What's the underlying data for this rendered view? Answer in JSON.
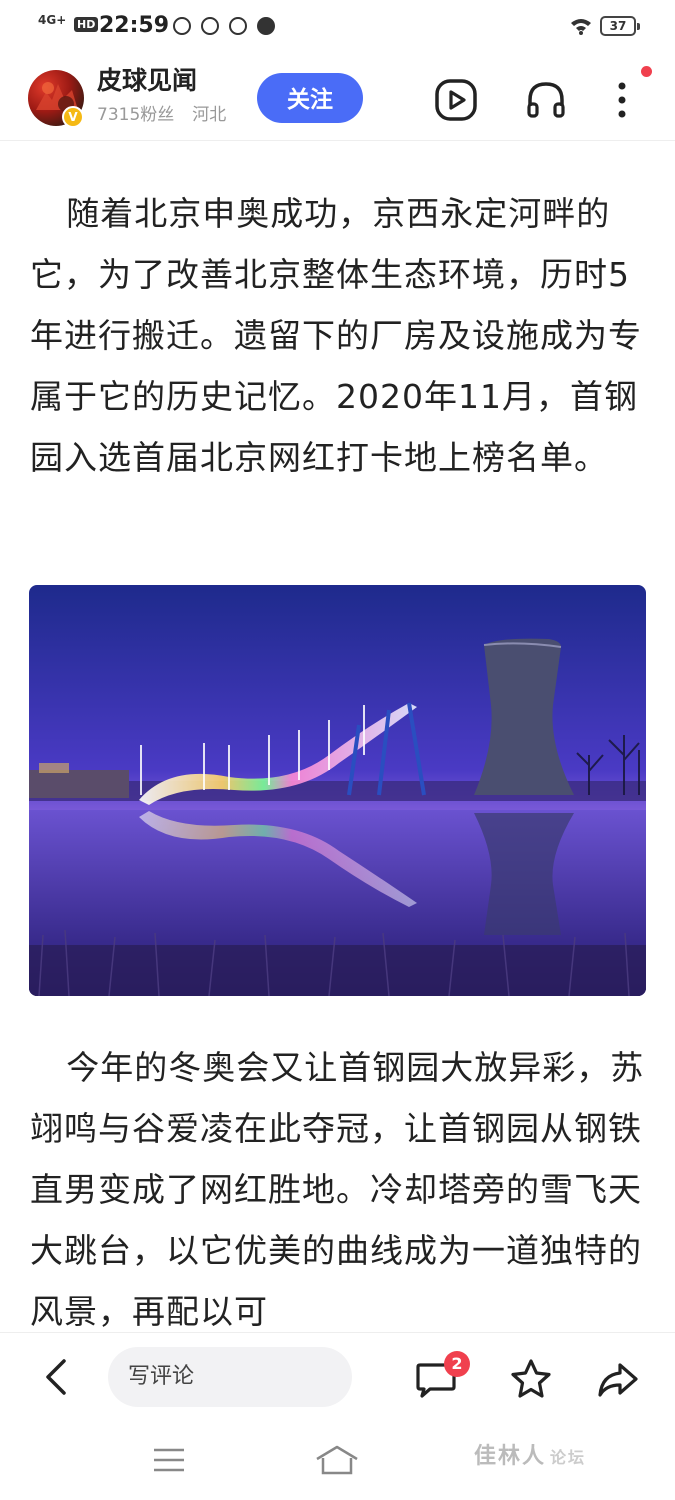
{
  "status_bar": {
    "network": "4G+",
    "hd": "HD",
    "time": "22:59",
    "battery": "37"
  },
  "author": {
    "name": "皮球见闻",
    "followers": "7315粉丝",
    "location": "河北",
    "verified_badge": "V",
    "follow_label": "关注"
  },
  "header_icons": [
    "play-video-icon",
    "headphones-icon",
    "more-vertical-icon"
  ],
  "article": {
    "paragraph_1": "随着北京申奥成功，京西永定河畔的它，为了改善北京整体生态环境，历时5年进行搬迁。遗留下的厂房及设施成为专属于它的历史记忆。2020年11月，首钢园入选首届北京网红打卡地上榜名单。",
    "paragraph_2": "今年的冬奥会又让首钢园大放异彩，苏翊鸣与谷爱凌在此夺冠，让首钢园从钢铁直男变成了网红胜地。冷却塔旁的雪飞天大跳台，以它优美的曲线成为一道独特的风景，再配以可"
  },
  "bottom_bar": {
    "comment_placeholder": "写评论",
    "comment_count": "2"
  },
  "watermark": {
    "text": "佳林人",
    "suffix": "论坛"
  },
  "colors": {
    "accent": "#4a6cf7",
    "badge": "#f0404e",
    "text": "#222222",
    "meta": "#999999"
  }
}
